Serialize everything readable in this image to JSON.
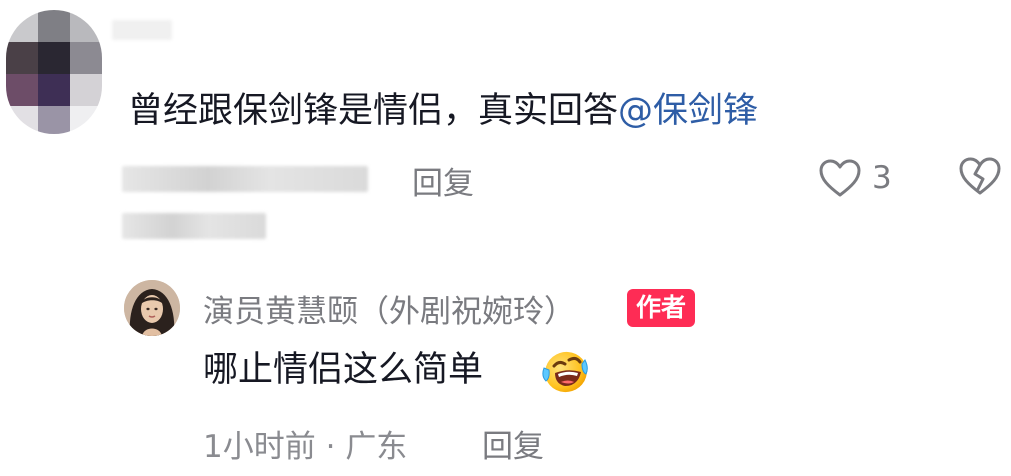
{
  "comment": {
    "text": "曾经跟保剑锋是情侣，真实回答",
    "mention": "@保剑锋",
    "reply_label": "回复",
    "like_count": "3"
  },
  "author_reply": {
    "name": "演员黄慧颐（外剧祝婉玲）",
    "badge": "作者",
    "text": "哪止情侣这么简单",
    "emoji": "crying-laughing-emoji",
    "time": "1小时前",
    "separator": "·",
    "location": "广东",
    "reply_label": "回复"
  },
  "icons": {
    "like": "heart-outline-icon",
    "dislike": "broken-heart-icon"
  },
  "colors": {
    "mention": "#2e5da6",
    "badge": "#fe2c55",
    "muted": "#7a7b80"
  }
}
